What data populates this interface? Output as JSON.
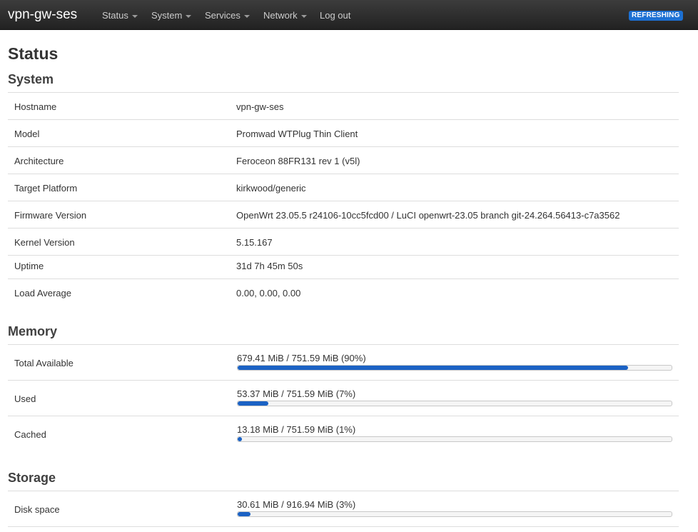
{
  "header": {
    "brand": "vpn-gw-ses",
    "menu": [
      {
        "label": "Status",
        "dropdown": true
      },
      {
        "label": "System",
        "dropdown": true
      },
      {
        "label": "Services",
        "dropdown": true
      },
      {
        "label": "Network",
        "dropdown": true
      },
      {
        "label": "Log out",
        "dropdown": false
      }
    ],
    "badge": "REFRESHING"
  },
  "page_title": "Status",
  "system": {
    "title": "System",
    "rows": [
      {
        "label": "Hostname",
        "value": "vpn-gw-ses"
      },
      {
        "label": "Model",
        "value": "Promwad WTPlug Thin Client"
      },
      {
        "label": "Architecture",
        "value": "Feroceon 88FR131 rev 1 (v5l)"
      },
      {
        "label": "Target Platform",
        "value": "kirkwood/generic"
      },
      {
        "label": "Firmware Version",
        "value": "OpenWrt 23.05.5 r24106-10cc5fcd00 / LuCI openwrt-23.05 branch git-24.264.56413-c7a3562"
      },
      {
        "label": "Kernel Version",
        "value": "5.15.167"
      },
      {
        "label": "Uptime",
        "value": "31d 7h 45m 50s"
      },
      {
        "label": "Load Average",
        "value": "0.00, 0.00, 0.00"
      }
    ]
  },
  "memory": {
    "title": "Memory",
    "rows": [
      {
        "label": "Total Available",
        "text": "679.41 MiB / 751.59 MiB (90%)",
        "fraction": 0.9
      },
      {
        "label": "Used",
        "text": "53.37 MiB / 751.59 MiB (7%)",
        "fraction": 0.07
      },
      {
        "label": "Cached",
        "text": "13.18 MiB / 751.59 MiB (1%)",
        "fraction": 0.01
      }
    ]
  },
  "storage": {
    "title": "Storage",
    "rows": [
      {
        "label": "Disk space",
        "text": "30.61 MiB / 916.94 MiB (3%)",
        "fraction": 0.03
      }
    ]
  },
  "colors": {
    "accent": "#1b62c4",
    "badge": "#1c70d3",
    "navbar": "#222222"
  }
}
